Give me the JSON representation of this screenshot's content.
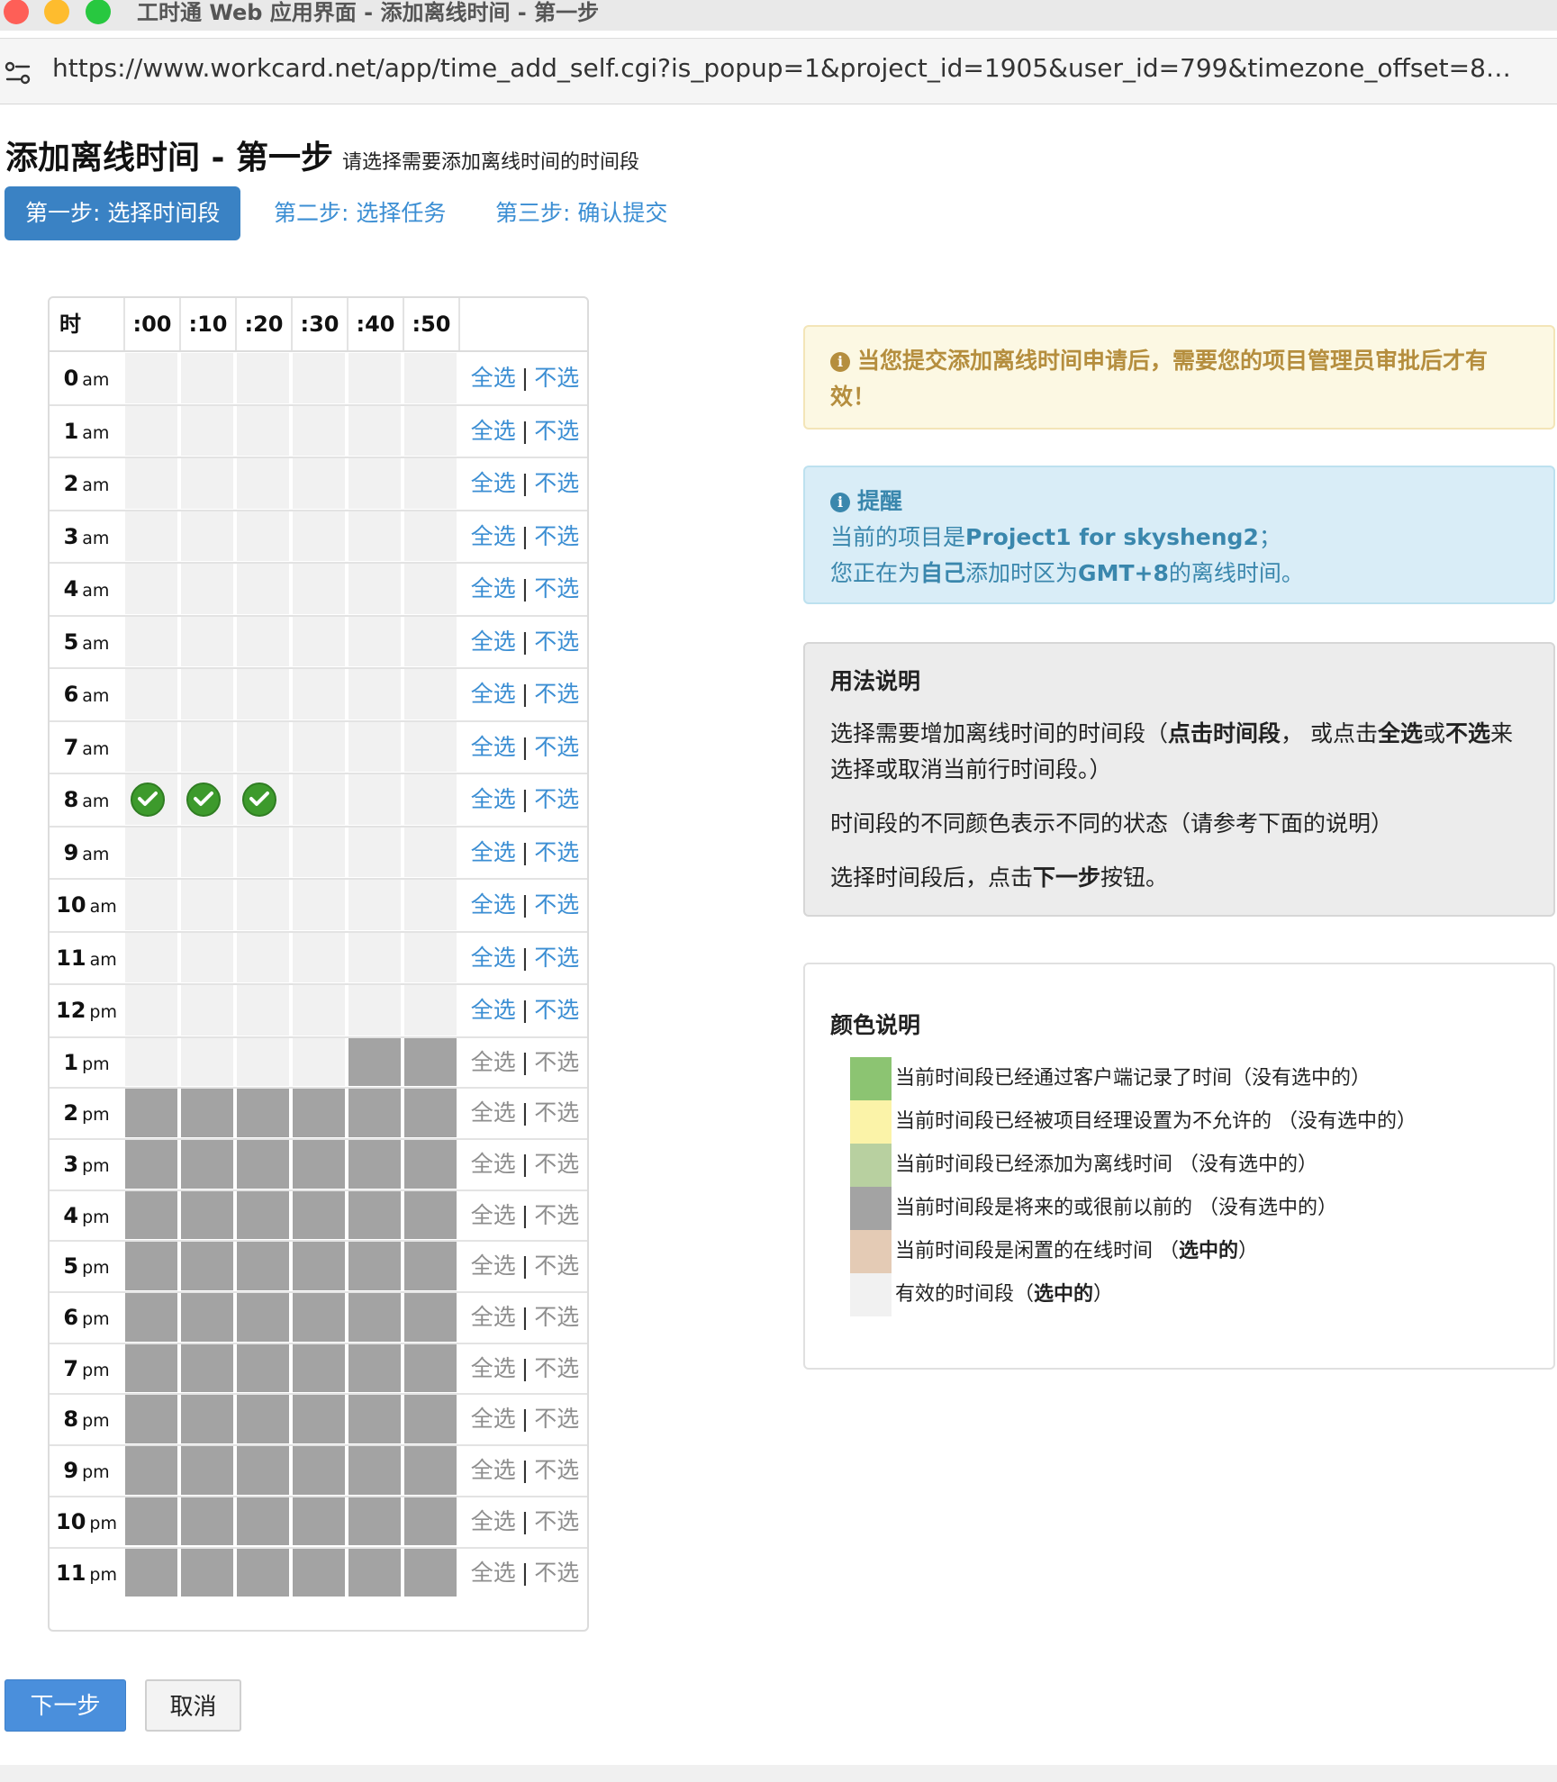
{
  "window": {
    "title": "工时通 Web 应用界面 - 添加离线时间 - 第一步",
    "url": "https://www.workcard.net/app/time_add_self.cgi?is_popup=1&project_id=1905&user_id=799&timezone_offset=8&selecte..."
  },
  "page": {
    "title": "添加离线时间 - 第一步",
    "subtitle": "请选择需要添加离线时间的时间段"
  },
  "steps": [
    {
      "label": "第一步: 选择时间段",
      "active": true
    },
    {
      "label": "第二步: 选择任务",
      "active": false
    },
    {
      "label": "第三步: 确认提交",
      "active": false
    }
  ],
  "grid": {
    "hour_header": "时",
    "minutes": [
      ":00",
      ":10",
      ":20",
      ":30",
      ":40",
      ":50"
    ],
    "select_all": "全选",
    "separator": "|",
    "select_none": "不选",
    "rows": [
      {
        "hour": "0",
        "ap": "am",
        "cells": [
          "v",
          "v",
          "v",
          "v",
          "v",
          "v"
        ],
        "actions_enabled": true
      },
      {
        "hour": "1",
        "ap": "am",
        "cells": [
          "v",
          "v",
          "v",
          "v",
          "v",
          "v"
        ],
        "actions_enabled": true
      },
      {
        "hour": "2",
        "ap": "am",
        "cells": [
          "v",
          "v",
          "v",
          "v",
          "v",
          "v"
        ],
        "actions_enabled": true
      },
      {
        "hour": "3",
        "ap": "am",
        "cells": [
          "v",
          "v",
          "v",
          "v",
          "v",
          "v"
        ],
        "actions_enabled": true
      },
      {
        "hour": "4",
        "ap": "am",
        "cells": [
          "v",
          "v",
          "v",
          "v",
          "v",
          "v"
        ],
        "actions_enabled": true
      },
      {
        "hour": "5",
        "ap": "am",
        "cells": [
          "v",
          "v",
          "v",
          "v",
          "v",
          "v"
        ],
        "actions_enabled": true
      },
      {
        "hour": "6",
        "ap": "am",
        "cells": [
          "v",
          "v",
          "v",
          "v",
          "v",
          "v"
        ],
        "actions_enabled": true
      },
      {
        "hour": "7",
        "ap": "am",
        "cells": [
          "v",
          "v",
          "v",
          "v",
          "v",
          "v"
        ],
        "actions_enabled": true
      },
      {
        "hour": "8",
        "ap": "am",
        "cells": [
          "s",
          "s",
          "s",
          "v",
          "v",
          "v"
        ],
        "actions_enabled": true
      },
      {
        "hour": "9",
        "ap": "am",
        "cells": [
          "v",
          "v",
          "v",
          "v",
          "v",
          "v"
        ],
        "actions_enabled": true
      },
      {
        "hour": "10",
        "ap": "am",
        "cells": [
          "v",
          "v",
          "v",
          "v",
          "v",
          "v"
        ],
        "actions_enabled": true
      },
      {
        "hour": "11",
        "ap": "am",
        "cells": [
          "v",
          "v",
          "v",
          "v",
          "v",
          "v"
        ],
        "actions_enabled": true
      },
      {
        "hour": "12",
        "ap": "pm",
        "cells": [
          "v",
          "v",
          "v",
          "v",
          "v",
          "v"
        ],
        "actions_enabled": true
      },
      {
        "hour": "1",
        "ap": "pm",
        "cells": [
          "v",
          "v",
          "v",
          "v",
          "f",
          "f"
        ],
        "actions_enabled": false
      },
      {
        "hour": "2",
        "ap": "pm",
        "cells": [
          "f",
          "f",
          "f",
          "f",
          "f",
          "f"
        ],
        "actions_enabled": false
      },
      {
        "hour": "3",
        "ap": "pm",
        "cells": [
          "f",
          "f",
          "f",
          "f",
          "f",
          "f"
        ],
        "actions_enabled": false
      },
      {
        "hour": "4",
        "ap": "pm",
        "cells": [
          "f",
          "f",
          "f",
          "f",
          "f",
          "f"
        ],
        "actions_enabled": false
      },
      {
        "hour": "5",
        "ap": "pm",
        "cells": [
          "f",
          "f",
          "f",
          "f",
          "f",
          "f"
        ],
        "actions_enabled": false
      },
      {
        "hour": "6",
        "ap": "pm",
        "cells": [
          "f",
          "f",
          "f",
          "f",
          "f",
          "f"
        ],
        "actions_enabled": false
      },
      {
        "hour": "7",
        "ap": "pm",
        "cells": [
          "f",
          "f",
          "f",
          "f",
          "f",
          "f"
        ],
        "actions_enabled": false
      },
      {
        "hour": "8",
        "ap": "pm",
        "cells": [
          "f",
          "f",
          "f",
          "f",
          "f",
          "f"
        ],
        "actions_enabled": false
      },
      {
        "hour": "9",
        "ap": "pm",
        "cells": [
          "f",
          "f",
          "f",
          "f",
          "f",
          "f"
        ],
        "actions_enabled": false
      },
      {
        "hour": "10",
        "ap": "pm",
        "cells": [
          "f",
          "f",
          "f",
          "f",
          "f",
          "f"
        ],
        "actions_enabled": false
      },
      {
        "hour": "11",
        "ap": "pm",
        "cells": [
          "f",
          "f",
          "f",
          "f",
          "f",
          "f"
        ],
        "actions_enabled": false
      }
    ]
  },
  "warning": {
    "text": "当您提交添加离线时间申请后，需要您的项目管理员审批后才有效！"
  },
  "reminder": {
    "title": "提醒",
    "line1_prefix": "当前的项目是",
    "project": "Project1 for skysheng2",
    "line1_suffix": "；",
    "line2_prefix": "您正在为",
    "self": "自己",
    "line2_mid": "添加时区为",
    "timezone": "GMT+8",
    "line2_suffix": "的离线时间。"
  },
  "usage": {
    "title": "用法说明",
    "p1_a": "选择需要增加离线时间的时间段（",
    "p1_b": "点击时间段",
    "p1_c": "， 或点击",
    "p1_d": "全选",
    "p1_e": "或",
    "p1_f": "不选",
    "p1_g": "来选择或取消当前行时间段。）",
    "p2": "时间段的不同颜色表示不同的状态（请参考下面的说明）",
    "p3_a": "选择时间段后，点击",
    "p3_b": "下一步",
    "p3_c": "按钮。"
  },
  "legend": {
    "title": "颜色说明",
    "items": [
      {
        "color": "#8cc472",
        "text": "当前时间段已经通过客户端记录了时间（没有选中的）",
        "bold": ""
      },
      {
        "color": "#fbf3a8",
        "text": "当前时间段已经被项目经理设置为不允许的 （没有选中的）",
        "bold": ""
      },
      {
        "color": "#b8d0a0",
        "text": "当前时间段已经添加为离线时间 （没有选中的）",
        "bold": ""
      },
      {
        "color": "#a3a3a3",
        "text": "当前时间段是将来的或很前以前的 （没有选中的）",
        "bold": ""
      },
      {
        "color": "#e4cbb5",
        "text": "当前时间段是闲置的在线时间 （",
        "bold": "选中的",
        "tail": "）"
      },
      {
        "color": "#f1f1f1",
        "text": "有效的时间段（",
        "bold": "选中的",
        "tail": "）"
      }
    ]
  },
  "buttons": {
    "next": "下一步",
    "cancel": "取消"
  },
  "colors": {
    "valid": "#f1f1f1",
    "future": "#a3a3a3",
    "link": "#3b8ed3",
    "active_step": "#3a82c4"
  }
}
